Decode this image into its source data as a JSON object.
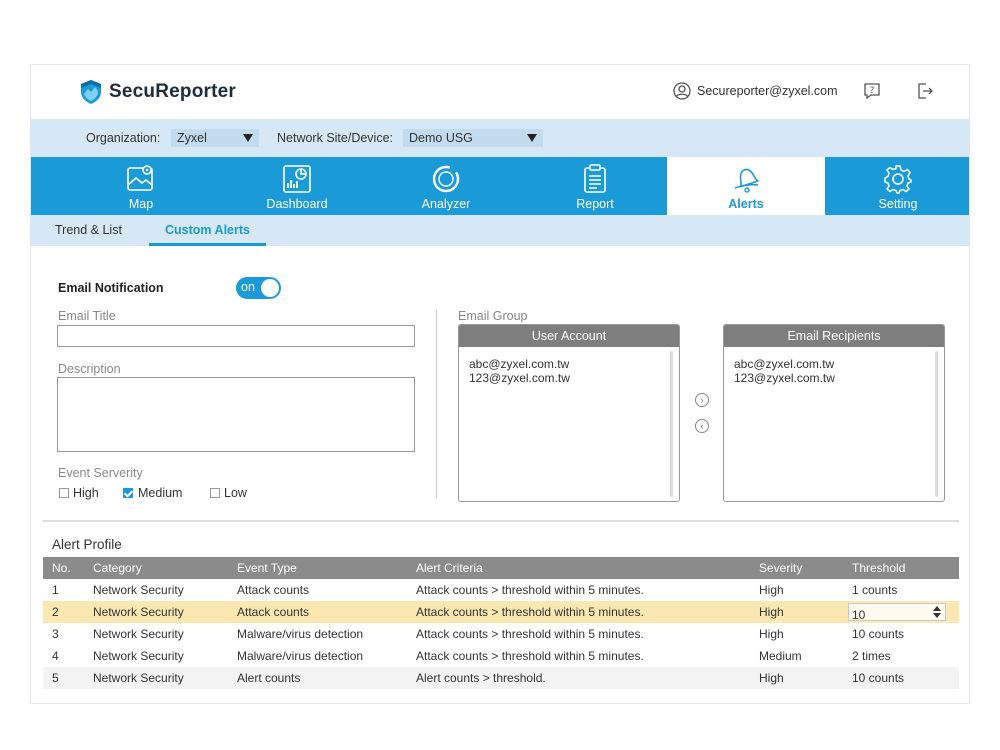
{
  "header": {
    "app_title": "SecuReporter",
    "user_email": "Secureporter@zyxel.com"
  },
  "filters": {
    "organization_label": "Organization:",
    "organization_value": "Zyxel",
    "site_label": "Network Site/Device:",
    "site_value": "Demo USG"
  },
  "nav": {
    "items": [
      {
        "label": "Map",
        "icon": "map-icon"
      },
      {
        "label": "Dashboard",
        "icon": "dashboard-icon"
      },
      {
        "label": "Analyzer",
        "icon": "analyzer-icon"
      },
      {
        "label": "Report",
        "icon": "report-icon"
      },
      {
        "label": "Alerts",
        "icon": "bell-icon",
        "active": true
      },
      {
        "label": "Setting",
        "icon": "gear-icon"
      }
    ]
  },
  "subtabs": [
    {
      "label": "Trend & List"
    },
    {
      "label": "Custom Alerts",
      "active": true
    }
  ],
  "form": {
    "email_notification_label": "Email Notification",
    "toggle_text": "on",
    "email_title_label": "Email Title",
    "email_title_value": "",
    "description_label": "Description",
    "description_value": "",
    "severity_label": "Event Serverity",
    "severity_options": [
      {
        "label": "High",
        "checked": false
      },
      {
        "label": "Medium",
        "checked": true
      },
      {
        "label": "Low",
        "checked": false
      }
    ],
    "email_group_label": "Email Group",
    "user_account_header": "User Account",
    "user_accounts": [
      "abc@zyxel.com.tw",
      "123@zyxel.com.tw"
    ],
    "recipients_header": "Email Recipients",
    "recipients": [
      "abc@zyxel.com.tw",
      "123@zyxel.com.tw"
    ],
    "move_right_glyph": "›",
    "move_left_glyph": "‹"
  },
  "alert_profile": {
    "title": "Alert Profile",
    "columns": [
      "No.",
      "Category",
      "Event Type",
      "Alert Criteria",
      "Severity",
      "Threshold"
    ],
    "rows": [
      {
        "no": "1",
        "category": "Network Security",
        "event_type": "Attack counts",
        "criteria": "Attack counts > threshold within 5 minutes.",
        "severity": "High",
        "threshold": "1 counts"
      },
      {
        "no": "2",
        "category": "Network Security",
        "event_type": "Attack counts",
        "criteria": "Attack counts > threshold within 5 minutes.",
        "severity": "High",
        "threshold": "10",
        "editing": true
      },
      {
        "no": "3",
        "category": "Network Security",
        "event_type": "Malware/virus detection",
        "criteria": "Attack counts > threshold within 5 minutes.",
        "severity": "High",
        "threshold": "10 counts"
      },
      {
        "no": "4",
        "category": "Network Security",
        "event_type": "Malware/virus detection",
        "criteria": "Attack counts > threshold within 5 minutes.",
        "severity": "Medium",
        "threshold": "2 times"
      },
      {
        "no": "5",
        "category": "Network Security",
        "event_type": "Alert counts",
        "criteria": "Alert counts > threshold.",
        "severity": "High",
        "threshold": "10 counts"
      }
    ]
  },
  "colors": {
    "accent": "#1a9ad6",
    "filter_bg": "#d6e8f5",
    "highlight_row": "#fbe7b0",
    "table_header": "#8b8b8b"
  }
}
